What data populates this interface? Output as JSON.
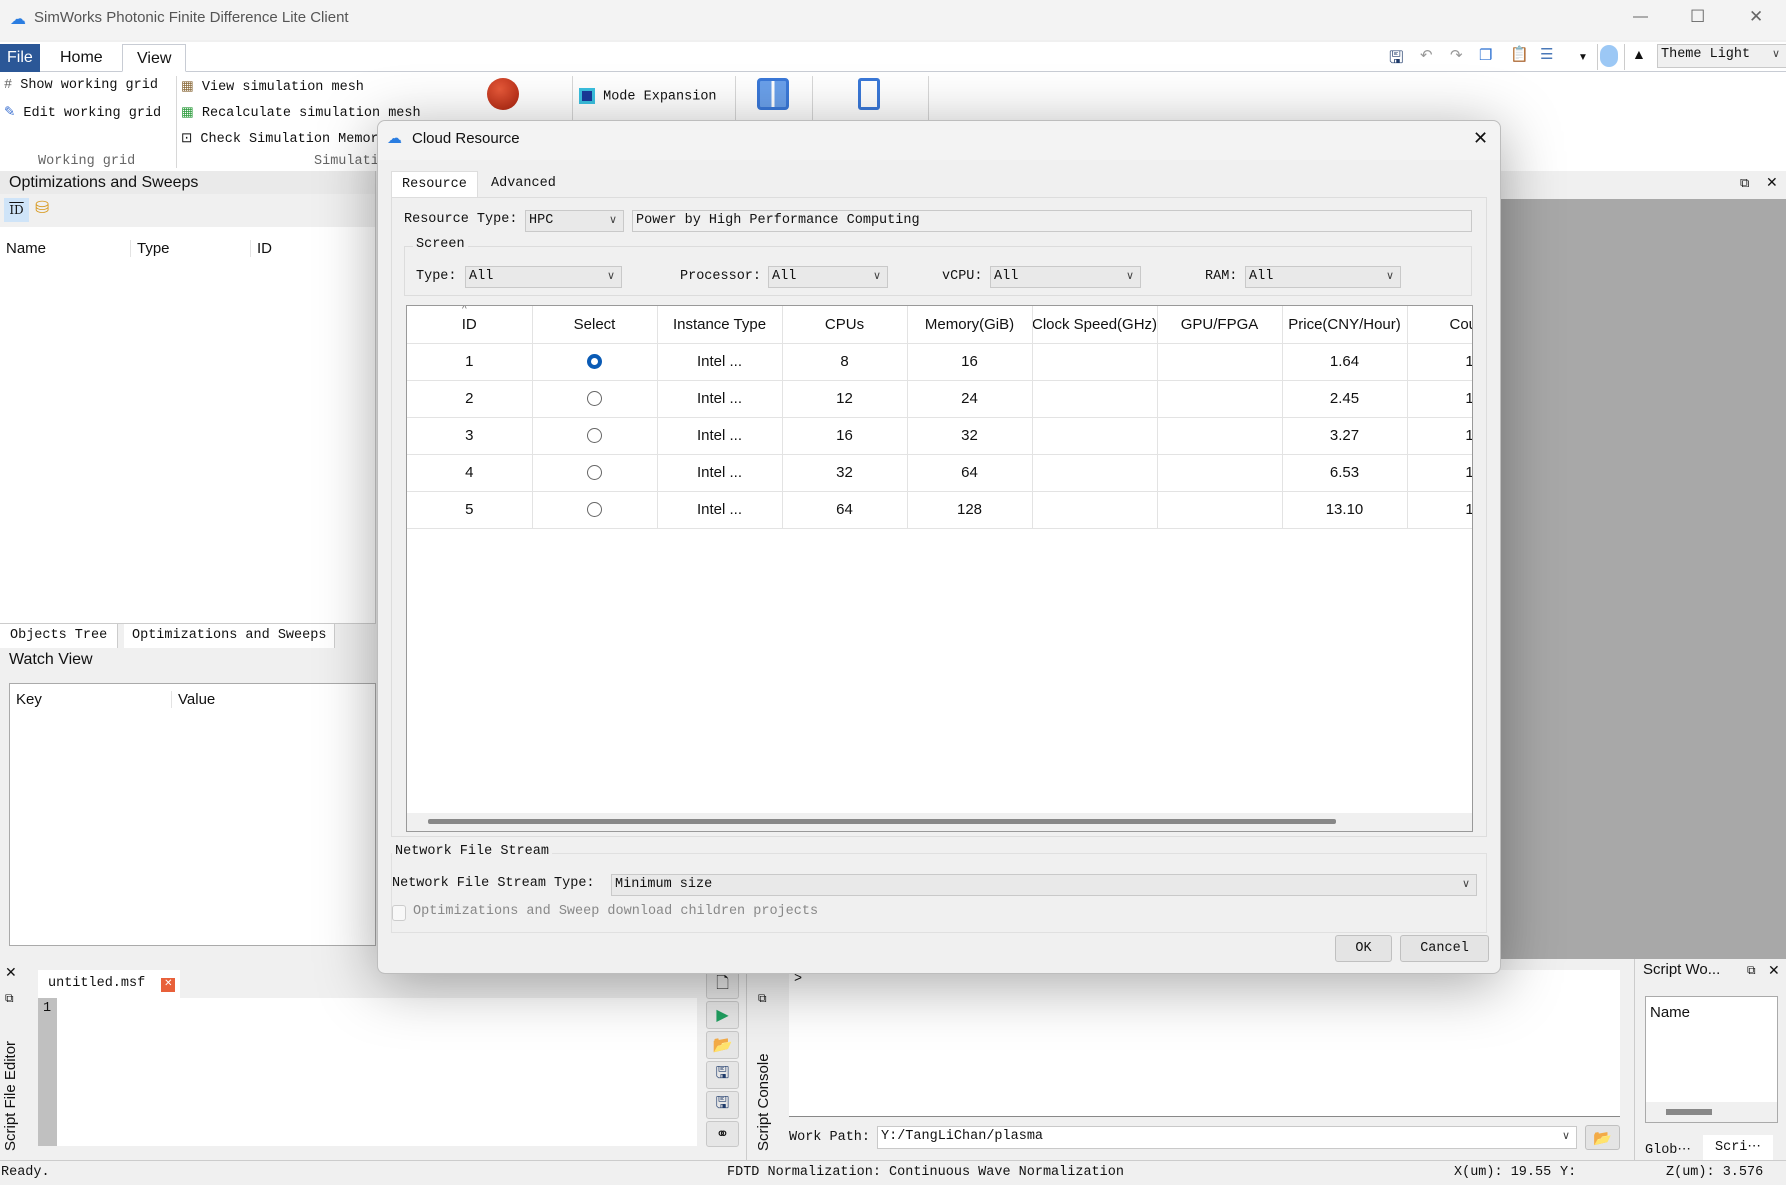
{
  "app": {
    "title": "SimWorks Photonic Finite Difference Lite Client",
    "window_controls": {
      "minimize": "—",
      "maximize": "☐",
      "close": "✕"
    }
  },
  "menu": {
    "tabs": [
      "File",
      "Home",
      "View"
    ],
    "theme": "Theme Light"
  },
  "ribbon": {
    "working_grid": {
      "items": [
        "Show working grid",
        "Edit working grid"
      ],
      "group": "Working grid"
    },
    "simulation": {
      "items": [
        "View simulation mesh",
        "Recalculate simulation mesh",
        "Check Simulation Memory"
      ],
      "group": "Simulation"
    },
    "mode_expansion": "Mode Expansion"
  },
  "left_panel": {
    "title": "Optimizations and Sweeps",
    "columns": [
      "Name",
      "Type",
      "ID"
    ],
    "bottom_tabs": [
      "Objects Tree",
      "Optimizations and Sweeps"
    ]
  },
  "watch_view": {
    "title": "Watch View",
    "columns": [
      "Key",
      "Value"
    ]
  },
  "dialog": {
    "title": "Cloud Resource",
    "close": "✕",
    "tabs": [
      "Resource",
      "Advanced"
    ],
    "resource_type_label": "Resource Type:",
    "resource_type": "HPC",
    "resource_desc": "Power by High Performance Computing",
    "screen": {
      "legend": "Screen",
      "filters": [
        {
          "label": "Type:",
          "value": "All"
        },
        {
          "label": "Processor:",
          "value": "All"
        },
        {
          "label": "vCPU:",
          "value": "All"
        },
        {
          "label": "RAM:",
          "value": "All"
        }
      ]
    },
    "table": {
      "columns": [
        "ID",
        "Select",
        "Instance Type",
        "CPUs",
        "Memory(GiB)",
        "Clock Speed(GHz)",
        "GPU/FPGA",
        "Price(CNY/Hour)",
        "Count"
      ],
      "selected_id": "1",
      "rows": [
        [
          "1",
          "",
          "Intel ...",
          "8",
          "16",
          "",
          "",
          "1.64",
          "1"
        ],
        [
          "2",
          "",
          "Intel ...",
          "12",
          "24",
          "",
          "",
          "2.45",
          "1"
        ],
        [
          "3",
          "",
          "Intel ...",
          "16",
          "32",
          "",
          "",
          "3.27",
          "1"
        ],
        [
          "4",
          "",
          "Intel ...",
          "32",
          "64",
          "",
          "",
          "6.53",
          "1"
        ],
        [
          "5",
          "",
          "Intel ...",
          "64",
          "128",
          "",
          "",
          "13.10",
          "1"
        ]
      ]
    },
    "network": {
      "legend": "Network File Stream",
      "type_label": "Network File Stream Type:",
      "type_value": "Minimum size",
      "checkbox_label": "Optimizations and Sweep download children projects",
      "checkbox_checked": false
    },
    "ok": "OK",
    "cancel": "Cancel"
  },
  "script_editor": {
    "title": "Script File Editor",
    "tab": "untitled.msf",
    "line_number": "1"
  },
  "script_console": {
    "title": "Script Console",
    "prompt": ">",
    "work_path_label": "Work Path:",
    "work_path": "Y:/TangLiChan/plasma"
  },
  "script_workspace": {
    "title": "Script Wo...",
    "columns": [
      "Name"
    ],
    "tabs": [
      "Glob⋯",
      "Scri⋯"
    ]
  },
  "status": {
    "ready": "Ready.",
    "normalization": "FDTD Normalization: Continuous Wave Normalization",
    "x": "X(um): 19.55",
    "y": "Y:",
    "z": "Z(um): 3.576"
  },
  "colors": {
    "accent": "#2b5797",
    "radio": "#0a5bb5"
  }
}
